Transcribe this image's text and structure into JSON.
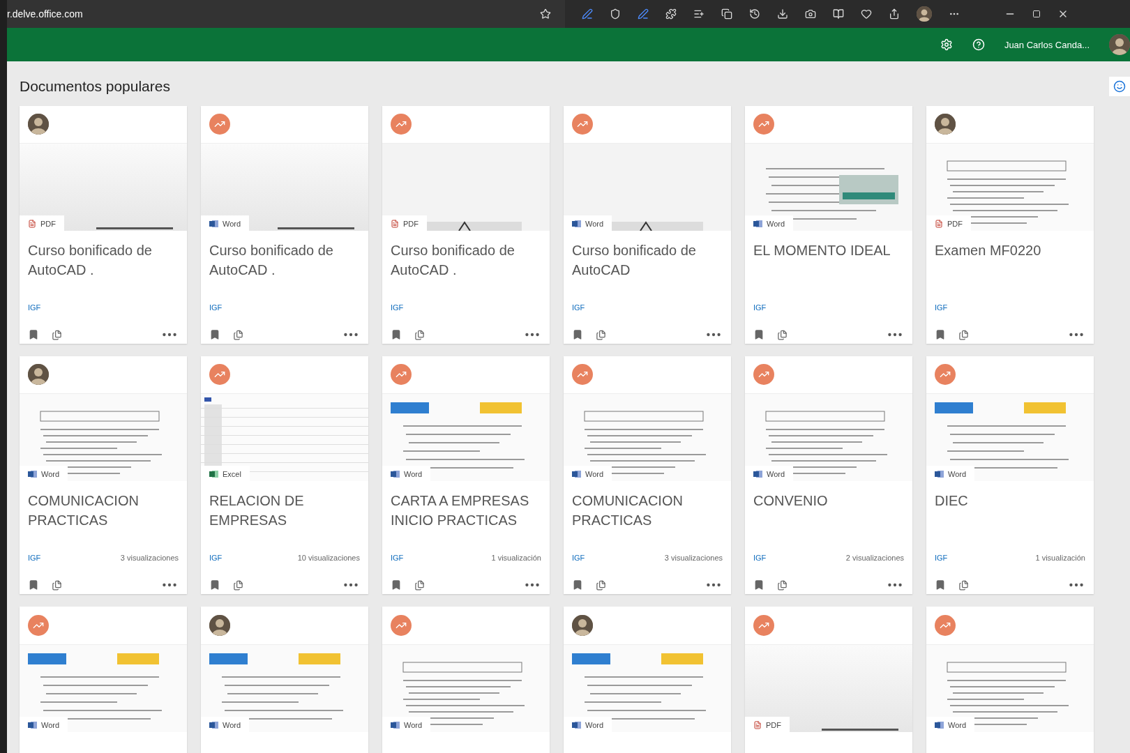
{
  "browser": {
    "address": "r.delve.office.com"
  },
  "header": {
    "user_name": "Juan Carlos Canda..."
  },
  "section": {
    "title": "Documentos populares"
  },
  "cards": [
    {
      "avatar": {
        "kind": "person"
      },
      "file_type": "PDF",
      "title": "Curso bonificado de AutoCAD .",
      "source": "IGF"
    },
    {
      "avatar": {
        "kind": "trending"
      },
      "file_type": "Word",
      "title": "Curso bonificado de AutoCAD .",
      "source": "IGF"
    },
    {
      "avatar": {
        "kind": "trending"
      },
      "file_type": "PDF",
      "title": "Curso bonificado de AutoCAD .",
      "source": "IGF"
    },
    {
      "avatar": {
        "kind": "trending"
      },
      "file_type": "Word",
      "title": "Curso bonificado de AutoCAD",
      "source": "IGF"
    },
    {
      "avatar": {
        "kind": "trending"
      },
      "file_type": "Word",
      "title": "EL MOMENTO IDEAL",
      "source": "IGF"
    },
    {
      "avatar": {
        "kind": "person"
      },
      "file_type": "PDF",
      "title": "Examen MF0220",
      "source": "IGF"
    },
    {
      "avatar": {
        "kind": "person"
      },
      "file_type": "Word",
      "title": "COMUNICACION PRACTICAS",
      "source": "IGF",
      "views": "3 visualizaciones"
    },
    {
      "avatar": {
        "kind": "trending"
      },
      "file_type": "Excel",
      "title": "RELACION DE EMPRESAS",
      "source": "IGF",
      "views": "10 visualizaciones"
    },
    {
      "avatar": {
        "kind": "trending"
      },
      "file_type": "Word",
      "title": "CARTA A EMPRESAS INICIO PRACTICAS",
      "source": "IGF",
      "views": "1 visualización"
    },
    {
      "avatar": {
        "kind": "trending"
      },
      "file_type": "Word",
      "title": "COMUNICACION PRACTICAS",
      "source": "IGF",
      "views": "3 visualizaciones"
    },
    {
      "avatar": {
        "kind": "trending"
      },
      "file_type": "Word",
      "title": "CONVENIO",
      "source": "IGF",
      "views": "2 visualizaciones"
    },
    {
      "avatar": {
        "kind": "trending"
      },
      "file_type": "Word",
      "title": "DIEC",
      "source": "IGF",
      "views": "1 visualización"
    },
    {
      "avatar": {
        "kind": "trending"
      },
      "file_type": "Word"
    },
    {
      "avatar": {
        "kind": "person"
      },
      "file_type": "Word"
    },
    {
      "avatar": {
        "kind": "trending"
      },
      "file_type": "Word"
    },
    {
      "avatar": {
        "kind": "person"
      },
      "file_type": "Word"
    },
    {
      "avatar": {
        "kind": "trending"
      },
      "file_type": "PDF"
    },
    {
      "avatar": {
        "kind": "trending"
      },
      "file_type": "Word"
    }
  ]
}
